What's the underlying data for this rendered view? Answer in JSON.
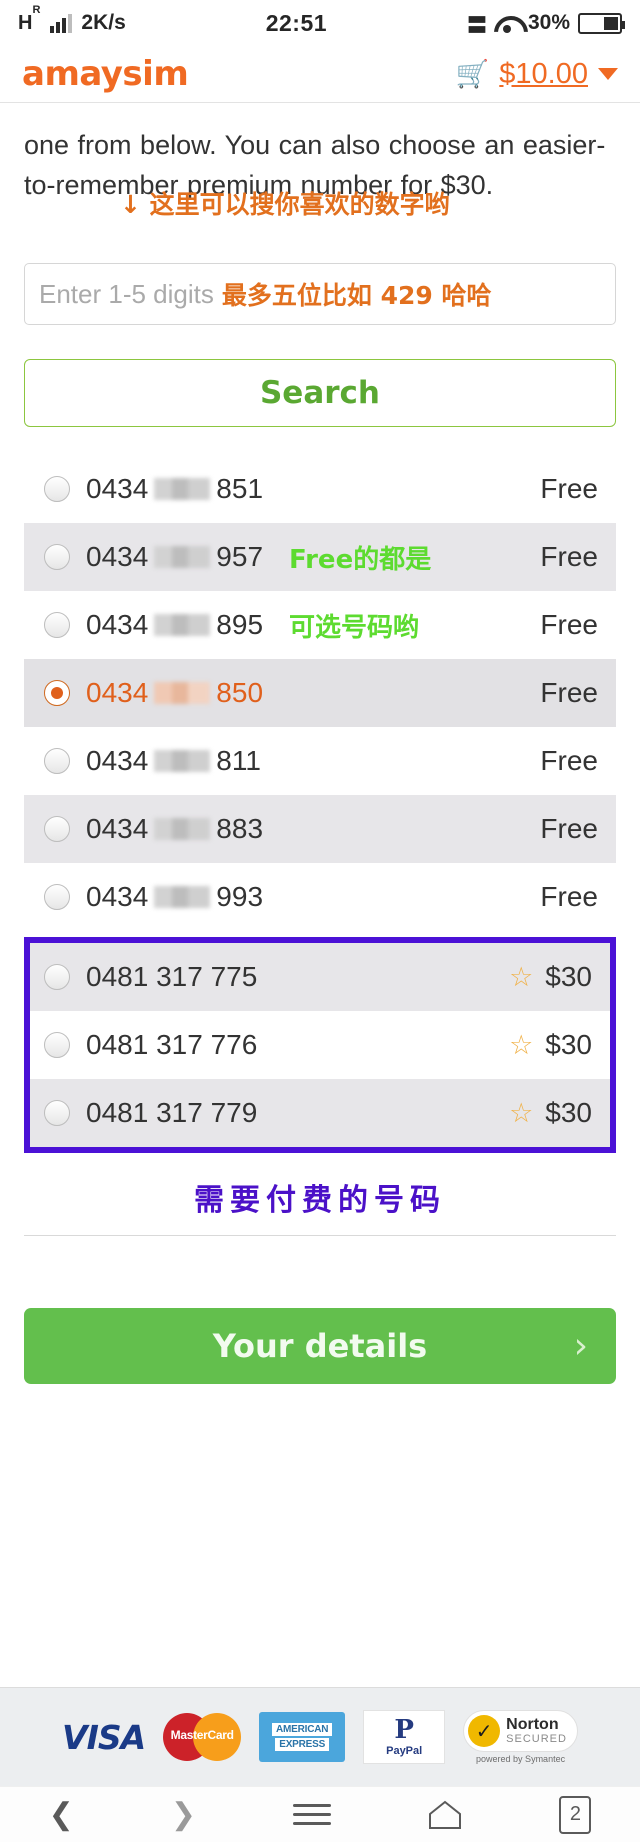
{
  "statusbar": {
    "network_type": "H",
    "network_sup": "R",
    "speed": "2K/s",
    "time": "22:51",
    "battery_percent": "30%",
    "vibrate_icon": "vibrate-icon",
    "wifi_icon": "wifi-icon",
    "battery_icon": "battery-icon",
    "signal_icon": "signal-bars-icon"
  },
  "header": {
    "logo": "amaysim",
    "cart_icon": "shopping-cart-icon",
    "cart_amount": "$10.00",
    "caret_icon": "chevron-down-icon"
  },
  "main": {
    "blurb": "one from below. You can also choose an easier-to-remember premium number for $30.",
    "annotation_search_hint": "↓ 这里可以搜你喜欢的数字哟",
    "search_input": {
      "placeholder": "Enter 1-5 digits",
      "value": "",
      "annotation": "最多五位比如 429 哈哈"
    },
    "search_button": "Search",
    "annotation_free_1": "Free的都是",
    "annotation_free_2": "可选号码哟",
    "annotation_premium": "需要付费的号码",
    "details_button": "Your details",
    "details_chevron": "chevron-right-icon",
    "star_icon": "star-icon"
  },
  "numbers": {
    "free": [
      {
        "prefix": "0434",
        "masked": true,
        "suffix": "851",
        "price": "Free",
        "selected": false,
        "alt": false,
        "annotation": ""
      },
      {
        "prefix": "0434",
        "masked": true,
        "suffix": "957",
        "price": "Free",
        "selected": false,
        "alt": true,
        "annotation": "Free的都是"
      },
      {
        "prefix": "0434",
        "masked": true,
        "suffix": "895",
        "price": "Free",
        "selected": false,
        "alt": false,
        "annotation": "可选号码哟"
      },
      {
        "prefix": "0434",
        "masked": true,
        "suffix": "850",
        "price": "Free",
        "selected": true,
        "alt": false,
        "annotation": ""
      },
      {
        "prefix": "0434",
        "masked": true,
        "suffix": "811",
        "price": "Free",
        "selected": false,
        "alt": false,
        "annotation": ""
      },
      {
        "prefix": "0434",
        "masked": true,
        "suffix": "883",
        "price": "Free",
        "selected": false,
        "alt": true,
        "annotation": ""
      },
      {
        "prefix": "0434",
        "masked": true,
        "suffix": "993",
        "price": "Free",
        "selected": false,
        "alt": false,
        "annotation": ""
      }
    ],
    "premium": [
      {
        "number": "0481 317 775",
        "price": "$30",
        "selected": false,
        "alt": true
      },
      {
        "number": "0481 317 776",
        "price": "$30",
        "selected": false,
        "alt": false
      },
      {
        "number": "0481 317 779",
        "price": "$30",
        "selected": false,
        "alt": true
      }
    ]
  },
  "payment_badges": {
    "visa": "VISA",
    "mastercard": "MasterCard",
    "amex_line1": "AMERICAN",
    "amex_line2": "EXPRESS",
    "paypal_mark": "P",
    "paypal_text": "PayPal",
    "norton_line1": "Norton",
    "norton_line2": "SECURED",
    "norton_sub": "powered by Symantec"
  },
  "navbar": {
    "back_icon": "chevron-left-icon",
    "forward_icon": "chevron-right-icon",
    "menu_icon": "hamburger-menu-icon",
    "home_icon": "home-icon",
    "tabs_count": "2"
  },
  "colors": {
    "brand_orange": "#f06a23",
    "green": "#63bf4d",
    "annotation_orange": "#e2701e",
    "annotation_green": "#5ddb30",
    "annotation_purple": "#4b11c8",
    "highlight_border": "#4b11d6"
  }
}
